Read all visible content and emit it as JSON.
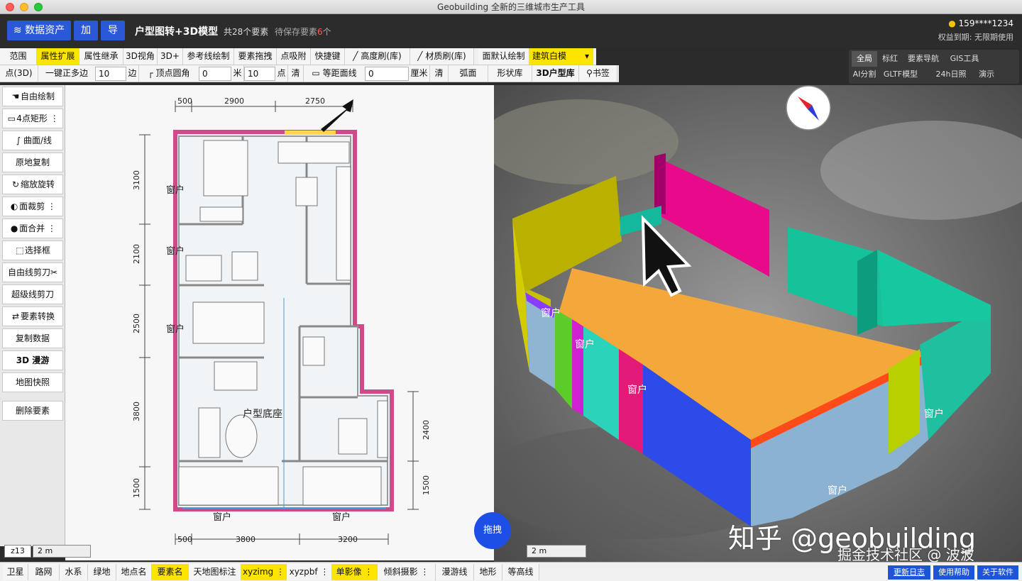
{
  "window": {
    "title": "Geobuilding 全新的三维城市生产工具"
  },
  "header": {
    "data_assets": "数据资产",
    "add": "加",
    "import": "导",
    "title": "户型图转+3D模型",
    "element_count": "共28个要素",
    "pending_prefix": "待保存要素",
    "pending_num": "6",
    "pending_unit": "个",
    "user": "159****1234",
    "expiry": "权益到期: 无限期使用"
  },
  "toolbar1": [
    "范围",
    "属性扩展",
    "属性继承",
    "3D视角",
    "3D+",
    "参考线绘制",
    "要素拖拽",
    "点吸附",
    "快捷键",
    "高度刷(库)",
    "材质刷(库)",
    "面默认绘制",
    "建筑白模"
  ],
  "toolbar2": {
    "point3d": "点(3D)",
    "polygon": "一键正多边",
    "sides_value": "10",
    "sides_unit": "边",
    "corner": "顶点圆角",
    "corner_value": "0",
    "corner_unit": "米",
    "pt_value": "10",
    "pt_unit": "点",
    "clear1": "清",
    "equidistant": "等距面线",
    "eq_value": "0",
    "eq_unit": "厘米",
    "clear2": "清",
    "arc": "弧面",
    "shape_lib": "形状库",
    "house_lib": "3D户型库",
    "bookmark": "书签"
  },
  "right_tabs": {
    "row1": [
      "全局",
      "标红",
      "要素导航",
      "GIS工具"
    ],
    "row2": [
      "AI分割",
      "GLTF模型",
      "24h日照",
      "演示"
    ]
  },
  "left_tools": [
    "自由绘制",
    "4点矩形",
    "曲面/线",
    "原地复制",
    "缩放旋转",
    "面裁剪",
    "面合并",
    "选择框",
    "自由线剪刀",
    "超级线剪刀",
    "要素转换",
    "复制数据",
    "3D 漫游",
    "地图快照",
    "删除要素"
  ],
  "plan": {
    "dims_top": [
      "500",
      "2900",
      "2750"
    ],
    "dims_bottom": [
      "500",
      "3800",
      "3200"
    ],
    "dims_left": [
      "3100",
      "2100",
      "2500",
      "3800",
      "1500"
    ],
    "dims_right": [
      "2400",
      "1500"
    ],
    "window_label": "窗户",
    "room_label": "户型底座",
    "scale": "2 m",
    "zoom": "z13"
  },
  "view3d": {
    "window_label": "窗户",
    "scale": "2 m",
    "drag": "拖拽",
    "watermark1": "知乎 @geobuilding",
    "watermark2": "掘金技术社区 @ 波波"
  },
  "bottom": [
    "卫星",
    "路网",
    "水系",
    "绿地",
    "地点名",
    "要素名",
    "天地图标注",
    "xyzimg",
    "xyzpbf",
    "单影像",
    "倾斜摄影",
    "漫游线",
    "地形",
    "等高线"
  ],
  "bottom_right": [
    "更新日志",
    "使用帮助",
    "关于软件"
  ],
  "colors": {
    "accent": "#2b58d8",
    "highlight": "#ffe400",
    "wall_outline": "#d04a8a"
  }
}
